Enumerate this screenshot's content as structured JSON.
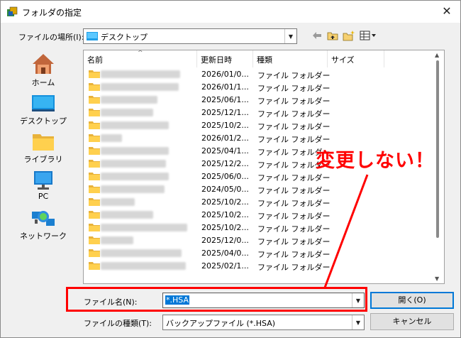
{
  "window": {
    "title": "フォルダの指定",
    "close_glyph": "✕"
  },
  "location": {
    "label": "ファイルの場所(I):",
    "value": "デスクトップ"
  },
  "toolbar": {
    "back": "back-icon",
    "up": "folder-up-icon",
    "new_folder": "new-folder-icon",
    "view_menu": "view-menu-icon"
  },
  "places": [
    {
      "label": "ホーム",
      "icon": "home-icon"
    },
    {
      "label": "デスクトップ",
      "icon": "desktop-icon"
    },
    {
      "label": "ライブラリ",
      "icon": "library-icon"
    },
    {
      "label": "PC",
      "icon": "pc-icon"
    },
    {
      "label": "ネットワーク",
      "icon": "network-icon"
    }
  ],
  "columns": {
    "name": "名前",
    "modified": "更新日時",
    "type": "種類",
    "size": "サイズ"
  },
  "files": [
    {
      "date": "2026/01/0...",
      "type": "ファイル フォルダー"
    },
    {
      "date": "2026/01/1...",
      "type": "ファイル フォルダー"
    },
    {
      "date": "2025/06/1...",
      "type": "ファイル フォルダー"
    },
    {
      "date": "2025/12/1...",
      "type": "ファイル フォルダー"
    },
    {
      "date": "2025/10/2...",
      "type": "ファイル フォルダー"
    },
    {
      "date": "2026/01/2...",
      "type": "ファイル フォルダー"
    },
    {
      "date": "2025/04/1...",
      "type": "ファイル フォルダー"
    },
    {
      "date": "2025/12/2...",
      "type": "ファイル フォルダー"
    },
    {
      "date": "2025/06/0...",
      "type": "ファイル フォルダー"
    },
    {
      "date": "2024/05/0...",
      "type": "ファイル フォルダー"
    },
    {
      "date": "2025/10/2...",
      "type": "ファイル フォルダー"
    },
    {
      "date": "2025/10/2...",
      "type": "ファイル フォルダー"
    },
    {
      "date": "2025/10/2...",
      "type": "ファイル フォルダー"
    },
    {
      "date": "2025/12/0...",
      "type": "ファイル フォルダー"
    },
    {
      "date": "2025/04/0...",
      "type": "ファイル フォルダー"
    },
    {
      "date": "2025/02/1...",
      "type": "ファイル フォルダー"
    }
  ],
  "filename": {
    "label": "ファイル名(N):",
    "value": "*.HSA"
  },
  "filetype": {
    "label": "ファイルの種類(T):",
    "value": "バックアップファイル (*.HSA)"
  },
  "buttons": {
    "open": "開く(O)",
    "cancel": "キャンセル"
  },
  "annotation": {
    "text": "変更しない！",
    "color": "#ff0000"
  },
  "colors": {
    "folder": "#ffc83d",
    "selection": "#0078d7",
    "accent": "#ff0000"
  }
}
